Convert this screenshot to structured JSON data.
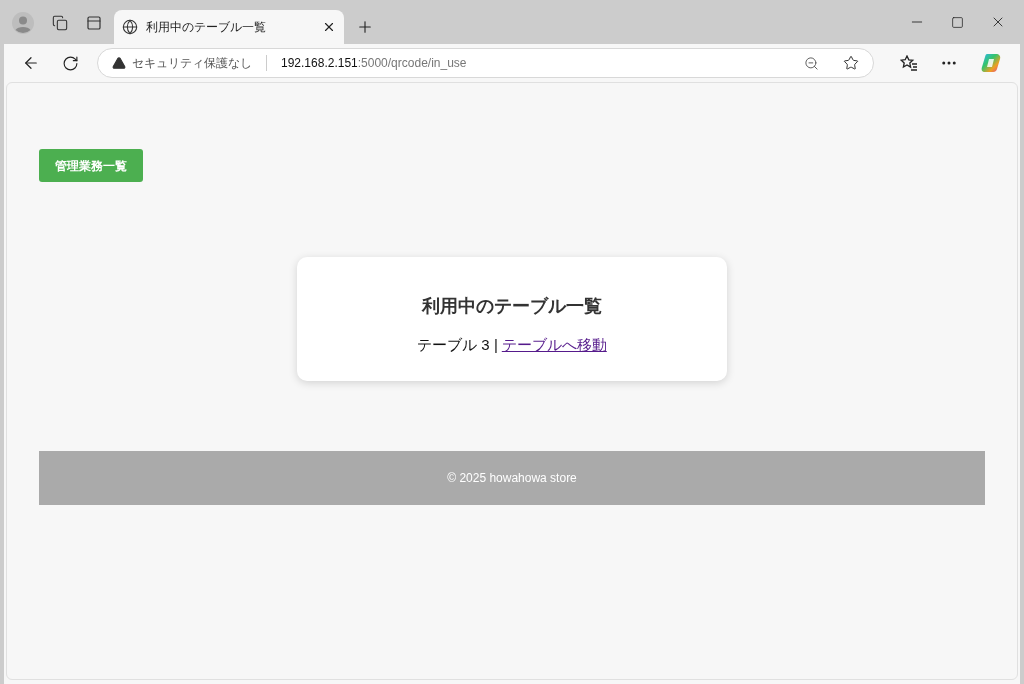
{
  "browser": {
    "tab": {
      "title": "利用中のテーブル一覧"
    },
    "address_bar": {
      "security": "セキュリティ保護なし",
      "host": "192.168.2.151",
      "path": ":5000/qrcode/in_use"
    }
  },
  "page": {
    "nav_button": "管理業務一覧",
    "card": {
      "title": "利用中のテーブル一覧",
      "rows": [
        {
          "label": "テーブル 3 |",
          "link": "テーブルへ移動"
        }
      ]
    },
    "footer": "© 2025 howahowa store"
  }
}
